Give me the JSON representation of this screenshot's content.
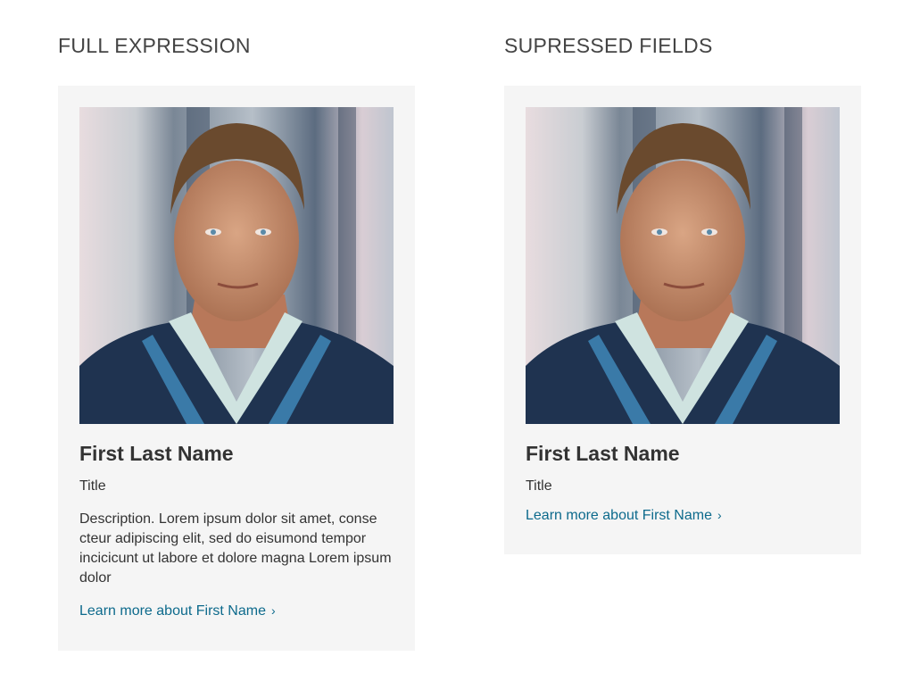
{
  "left": {
    "heading": "FULL EXPRESSION",
    "card": {
      "name": "First Last Name",
      "title": "Title",
      "description": "Description. Lorem ipsum dolor sit amet, conse cteur adipiscing elit, sed do eisumond tempor incicicunt ut labore et dolore magna Lorem ipsum dolor",
      "link_label": "Learn more about First Name",
      "link_icon": "chevron-right-icon"
    }
  },
  "right": {
    "heading": "SUPRESSED FIELDS",
    "card": {
      "name": "First Last Name",
      "title": "Title",
      "link_label": "Learn more about First Name",
      "link_icon": "chevron-right-icon"
    }
  },
  "colors": {
    "card_background": "#f5f5f5",
    "link": "#0d6a8c",
    "text": "#333333"
  }
}
